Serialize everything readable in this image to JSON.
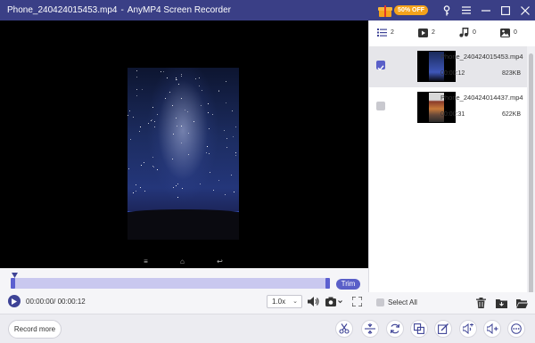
{
  "window": {
    "filename": "Phone_240424015453.mp4",
    "separator": "-",
    "app_name": "AnyMP4 Screen Recorder",
    "promo_badge": "50% OFF"
  },
  "colors": {
    "titlebar": "#3a3f86",
    "accent": "#5a5fc8",
    "promo": "#f3a21c"
  },
  "player": {
    "trim_label": "Trim",
    "time_display": "00:00:00/ 00:00:12",
    "speed": "1.0x",
    "progress_fraction": 0.0
  },
  "tabs": [
    {
      "icon": "list-icon",
      "count": "2"
    },
    {
      "icon": "video-icon",
      "count": "2"
    },
    {
      "icon": "music-note-icon",
      "count": "0"
    },
    {
      "icon": "image-icon",
      "count": "0"
    }
  ],
  "files": [
    {
      "name": "Phone_240424015453.mp4",
      "duration": "00:00:12",
      "size": "823KB",
      "checked": true
    },
    {
      "name": "Phone_240424014437.mp4",
      "duration": "00:00:31",
      "size": "622KB",
      "checked": false
    }
  ],
  "footer": {
    "select_all": "Select All"
  },
  "bottombar": {
    "record_more": "Record more"
  }
}
